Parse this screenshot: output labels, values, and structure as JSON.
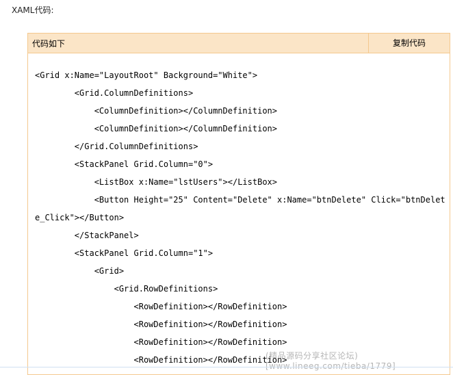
{
  "intro_label": "XAML代码:",
  "code_header": {
    "title": "代码如下",
    "copy_label": "复制代码"
  },
  "code_lines": [
    "<Grid x:Name=\"LayoutRoot\" Background=\"White\">",
    "        <Grid.ColumnDefinitions>",
    "            <ColumnDefinition></ColumnDefinition>",
    "            <ColumnDefinition></ColumnDefinition>",
    "        </Grid.ColumnDefinitions>",
    "        <StackPanel Grid.Column=\"0\">",
    "            <ListBox x:Name=\"lstUsers\"></ListBox>",
    "            <Button Height=\"25\" Content=\"Delete\" x:Name=\"btnDelete\" Click=\"btnDelet",
    "e_Click\"></Button>",
    "        </StackPanel>",
    "        <StackPanel Grid.Column=\"1\">",
    "            <Grid>",
    "                <Grid.RowDefinitions>",
    "                    <RowDefinition></RowDefinition>",
    "                    <RowDefinition></RowDefinition>",
    "                    <RowDefinition></RowDefinition>",
    "                    <RowDefinition></RowDefinition>"
  ],
  "watermark": "(精品源码分享社区论坛)[www.lineeg.com/tieba/1779]"
}
